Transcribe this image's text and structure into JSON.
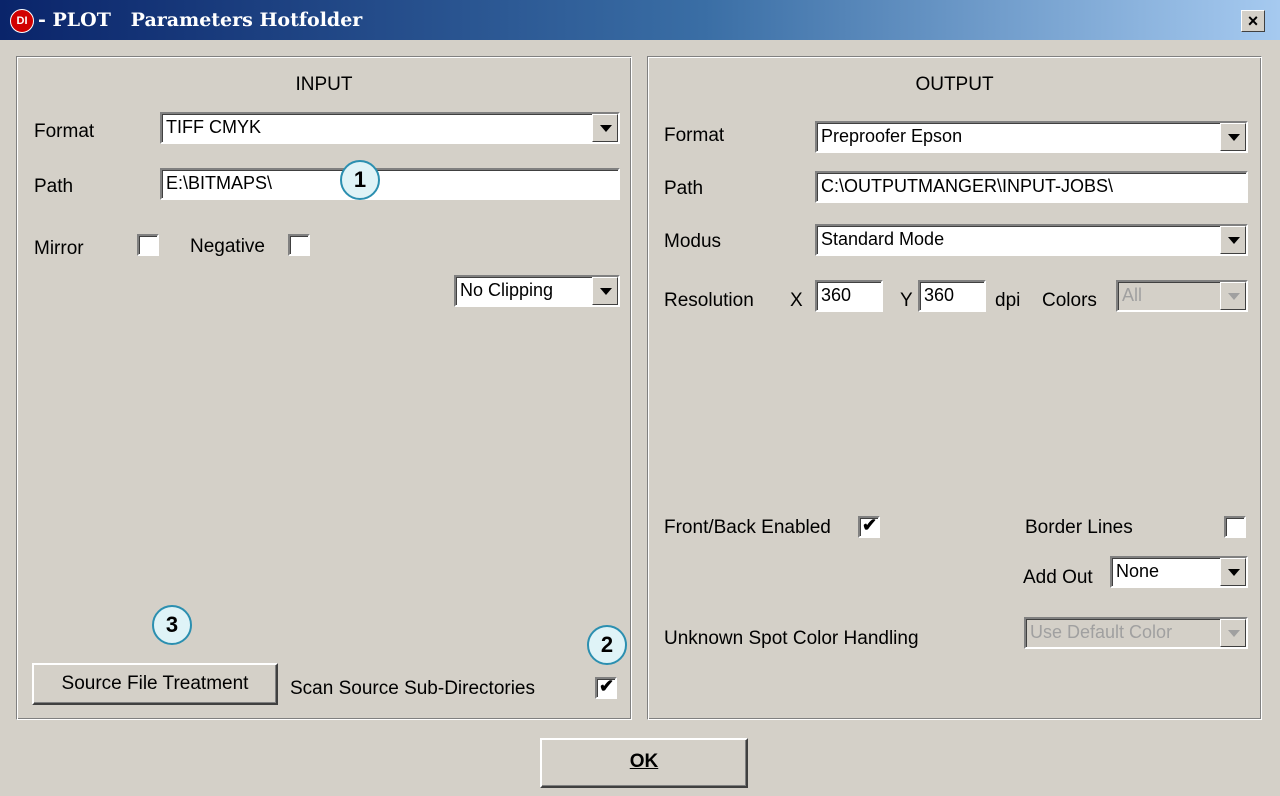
{
  "window": {
    "title": "- PLOT   Parameters Hotfolder",
    "app_icon": "DI",
    "close_glyph": "×"
  },
  "input": {
    "heading": "INPUT",
    "format_label": "Format",
    "format_value": "TIFF CMYK",
    "path_label": "Path",
    "path_value": "E:\\BITMAPS\\",
    "mirror_label": "Mirror",
    "mirror_checked": false,
    "negative_label": "Negative",
    "negative_checked": false,
    "clipping_value": "No Clipping",
    "source_button": "Source File Treatment",
    "scan_label": "Scan Source Sub-Directories",
    "scan_checked": true
  },
  "output": {
    "heading": "OUTPUT",
    "format_label": "Format",
    "format_value": "Preproofer Epson",
    "path_label": "Path",
    "path_value": "C:\\OUTPUTMANGER\\INPUT-JOBS\\",
    "modus_label": "Modus",
    "modus_value": "Standard Mode",
    "resolution_label": "Resolution",
    "x_label": "X",
    "x_value": "360",
    "y_label": "Y",
    "y_value": "360",
    "dpi_label": "dpi",
    "colors_label": "Colors",
    "colors_value": "All",
    "frontback_label": "Front/Back Enabled",
    "frontback_checked": true,
    "border_label": "Border Lines",
    "border_checked": false,
    "addout_label": "Add Out",
    "addout_value": "None",
    "spot_label": "Unknown Spot Color Handling",
    "spot_value": "Use Default Color"
  },
  "markers": [
    "1",
    "2",
    "3"
  ],
  "ok_button": "OK"
}
